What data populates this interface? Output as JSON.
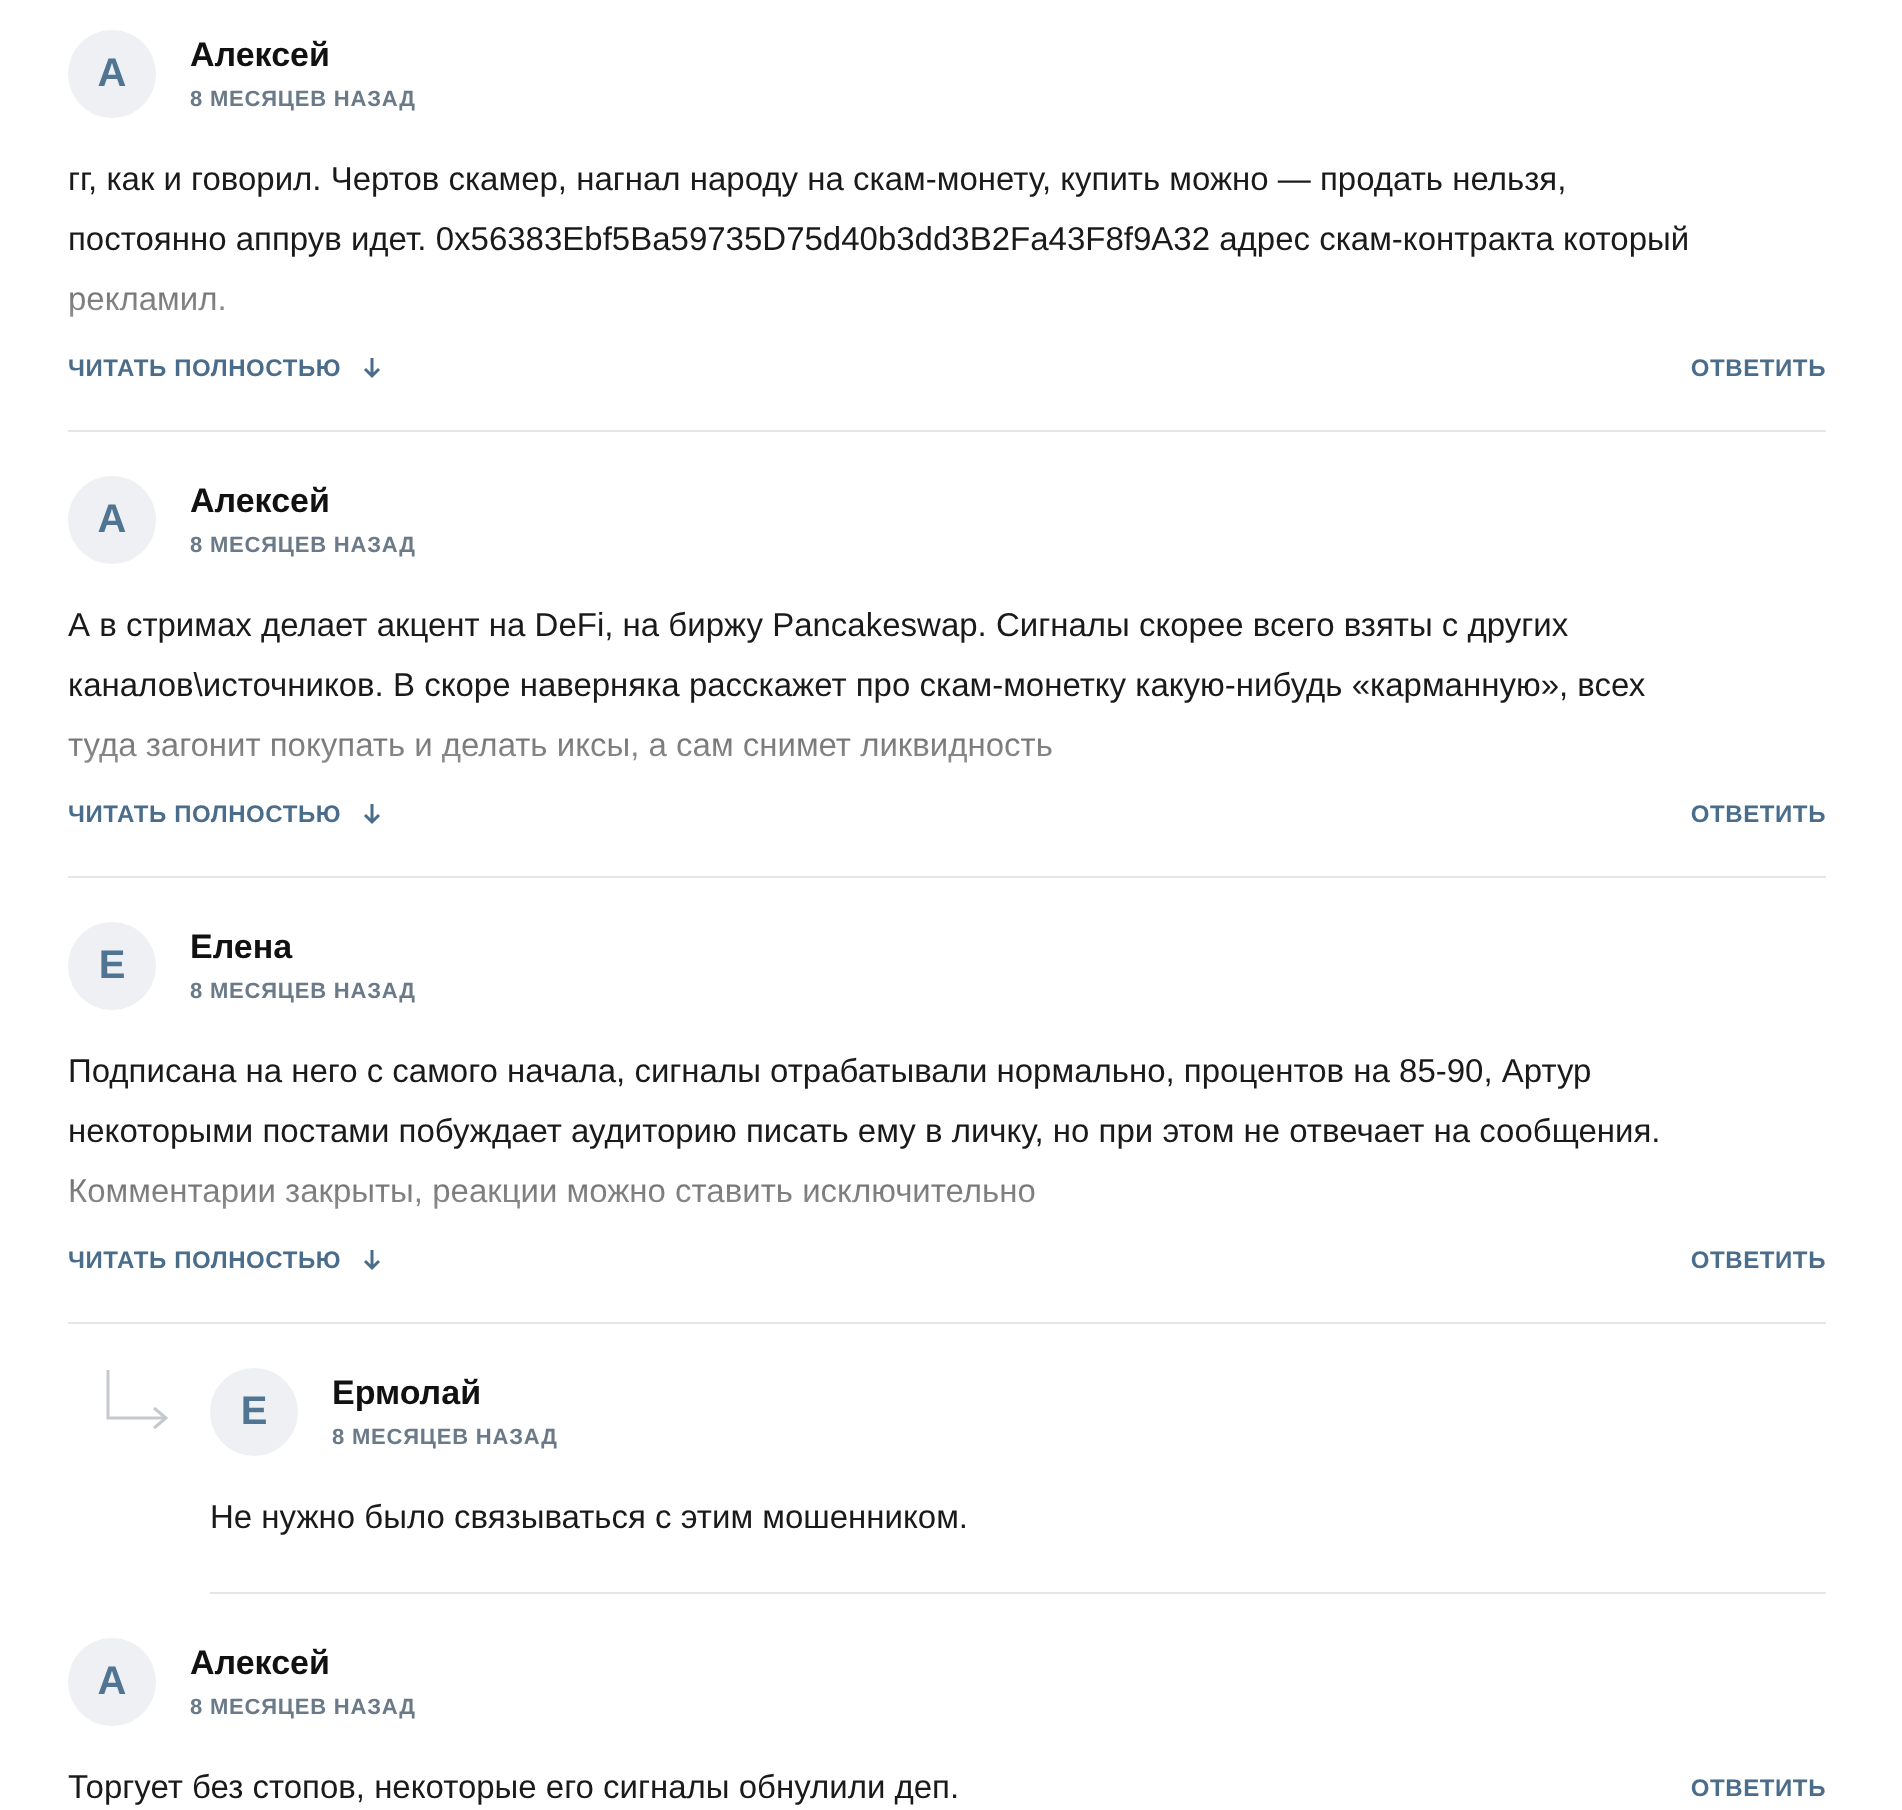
{
  "comments": [
    {
      "author": "Алексей",
      "initial": "А",
      "date": "8 МЕСЯЦЕВ НАЗАД",
      "text": "гг, как и говорил. Чертов скамер, нагнал народу на скам-монету, купить можно — продать нельзя, постоянно аппрув идет. 0x56383Ebf5Ba59735D75d40b3dd3B2Fa43F8f9A32 адрес скам-контракта который рекламил.",
      "truncated": true,
      "read_more": "ЧИТАТЬ ПОЛНОСТЬЮ",
      "reply": "ОТВЕТИТЬ"
    },
    {
      "author": "Алексей",
      "initial": "А",
      "date": "8 МЕСЯЦЕВ НАЗАД",
      "text": "А в стримах делает акцент на DeFi, на биржу Pancakeswap. Сигналы скорее всего взяты с других каналов\\источников. В скоре наверняка расскажет про скам-монетку какую-нибудь «карманную», всех туда загонит покупать и делать иксы, а сам снимет ликвидность",
      "truncated": true,
      "read_more": "ЧИТАТЬ ПОЛНОСТЬЮ",
      "reply": "ОТВЕТИТЬ"
    },
    {
      "author": "Елена",
      "initial": "Е",
      "date": "8 МЕСЯЦЕВ НАЗАД",
      "text": "Подписана на него с самого начала, сигналы отрабатывали нормально, процентов на 85-90, Артур некоторыми постами побуждает аудиторию писать ему в личку, но при этом не отвечает на сообщения. Комментарии закрыты, реакции можно ставить исключительно",
      "truncated": true,
      "read_more": "ЧИТАТЬ ПОЛНОСТЬЮ",
      "reply": "ОТВЕТИТЬ",
      "children": [
        {
          "author": "Ермолай",
          "initial": "Е",
          "date": "8 МЕСЯЦЕВ НАЗАД",
          "text": "Не нужно было связываться с этим мошенником.",
          "truncated": false
        }
      ]
    },
    {
      "author": "Алексей",
      "initial": "А",
      "date": "8 МЕСЯЦЕВ НАЗАД",
      "text": "Торгует без стопов, некоторые его сигналы обнулили деп.",
      "truncated": false,
      "reply": "ОТВЕТИТЬ"
    }
  ]
}
